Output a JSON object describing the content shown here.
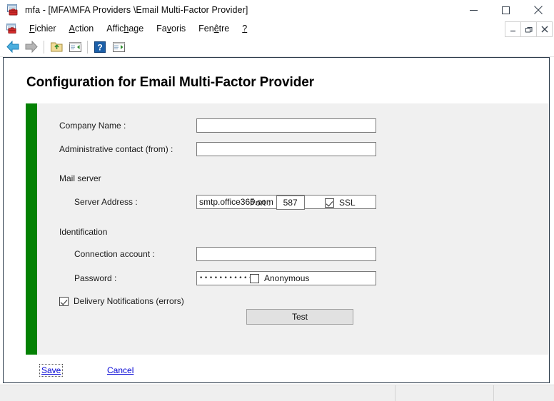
{
  "window": {
    "title": "mfa - [MFA\\MFA Providers \\Email Multi-Factor Provider]",
    "icon": "mmc-console-icon",
    "controls": {
      "minimize": "minimize-button",
      "maximize": "maximize-button",
      "close": "close-button"
    },
    "mdi_controls": {
      "minimize": "mdi-minimize-button",
      "restore": "mdi-restore-button",
      "close": "mdi-close-button"
    }
  },
  "menubar": {
    "items": [
      {
        "label": "Fichier",
        "mnemonic_index": 0
      },
      {
        "label": "Action",
        "mnemonic_index": 0
      },
      {
        "label": "Affichage",
        "mnemonic_index": 5
      },
      {
        "label": "Favoris",
        "mnemonic_index": 2
      },
      {
        "label": "Fenêtre",
        "mnemonic_index": 3
      },
      {
        "label": "?",
        "mnemonic_index": 0
      }
    ]
  },
  "toolbar": {
    "buttons": [
      {
        "name": "back-icon",
        "title": "Back"
      },
      {
        "name": "forward-icon",
        "title": "Forward"
      },
      {
        "name": "up-one-level-icon",
        "title": "Up One Level"
      },
      {
        "name": "show-hide-tree-icon",
        "title": "Show/Hide Console Tree"
      },
      {
        "name": "help-icon",
        "title": "Help"
      },
      {
        "name": "export-list-icon",
        "title": "Export List"
      }
    ]
  },
  "page": {
    "title": "Configuration for Email Multi-Factor Provider",
    "accent_color": "#038103",
    "panel_color": "#f0f0f0"
  },
  "form": {
    "company_name": {
      "label": "Company Name :",
      "value": "",
      "placeholder": ""
    },
    "admin_contact": {
      "label": "Administrative contact (from) :",
      "value": "",
      "placeholder": ""
    },
    "mail_server_section": "Mail server",
    "server_address": {
      "label": "Server Address :",
      "value": "smtp.office365.com",
      "placeholder": ""
    },
    "port": {
      "label": "Port :",
      "value": "587",
      "placeholder": ""
    },
    "ssl": {
      "label": "SSL",
      "checked": true
    },
    "identification_section": "Identification",
    "connection_account": {
      "label": "Connection account :",
      "value": "",
      "placeholder": ""
    },
    "password": {
      "label": "Password :",
      "value": "••••••••••••",
      "placeholder": ""
    },
    "anonymous": {
      "label": "Anonymous",
      "checked": false
    },
    "delivery_notifications": {
      "label": "Delivery Notifications (errors)",
      "checked": true
    },
    "test_button": "Test"
  },
  "actions": {
    "save": "Save",
    "cancel": "Cancel"
  },
  "statusbar": {
    "pane1": "",
    "pane2": "",
    "pane3": ""
  }
}
